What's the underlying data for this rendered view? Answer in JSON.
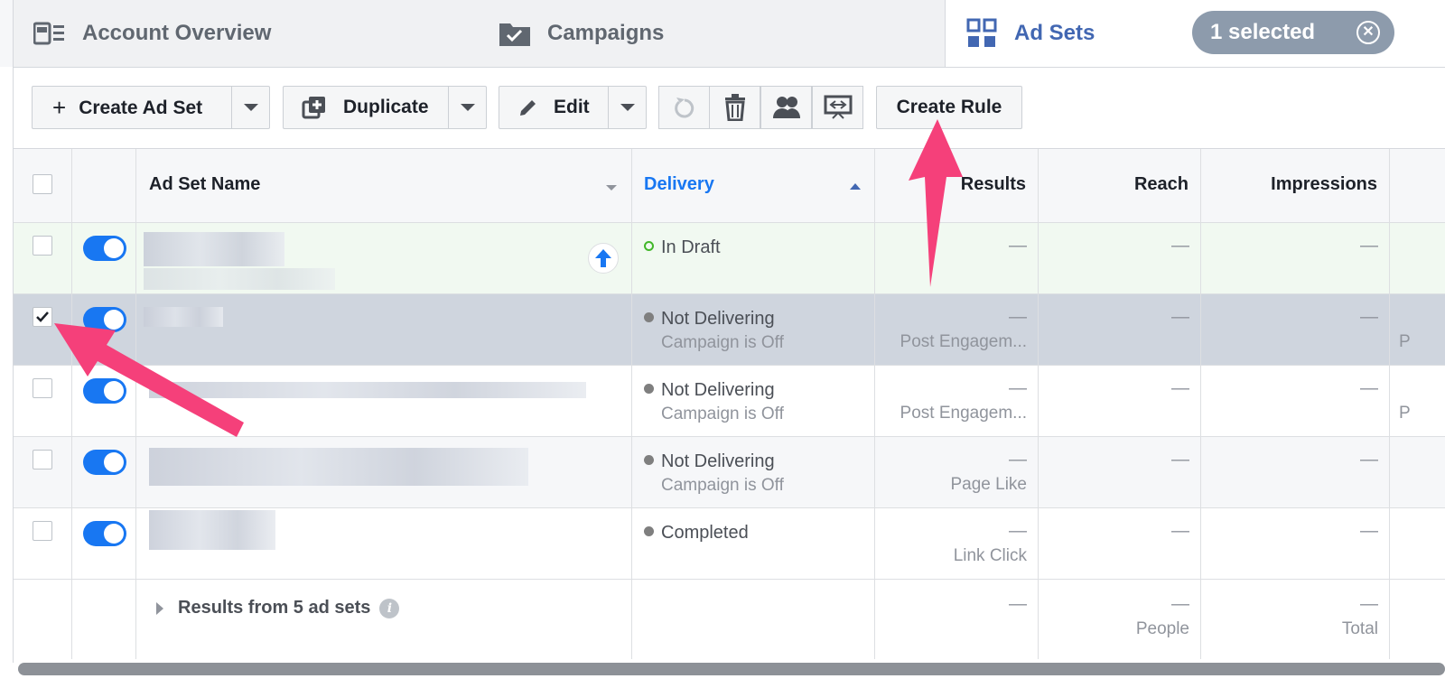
{
  "tabs": [
    {
      "label": "Account Overview",
      "icon": "account-overview-icon"
    },
    {
      "label": "Campaigns",
      "icon": "campaign-folder-icon"
    },
    {
      "label": "Ad Sets",
      "icon": "ad-sets-grid-icon"
    }
  ],
  "selection": {
    "label": "1 selected",
    "close_icon": "close-circle-icon"
  },
  "toolbar": {
    "create_label": "Create Ad Set",
    "duplicate_label": "Duplicate",
    "edit_label": "Edit",
    "create_rule_label": "Create Rule"
  },
  "table": {
    "headers": {
      "name": "Ad Set Name",
      "delivery": "Delivery",
      "results": "Results",
      "reach": "Reach",
      "impressions": "Impressions"
    },
    "dash": "—",
    "rows": [
      {
        "status": "In Draft",
        "sub": "",
        "result_sub": "",
        "checked": false
      },
      {
        "status": "Not Delivering",
        "sub": "Campaign is Off",
        "result_sub": "Post Engagem...",
        "checked": true
      },
      {
        "status": "Not Delivering",
        "sub": "Campaign is Off",
        "result_sub": "Post Engagem...",
        "checked": false
      },
      {
        "status": "Not Delivering",
        "sub": "Campaign is Off",
        "result_sub": "Page Like",
        "checked": false
      },
      {
        "status": "Completed",
        "sub": "",
        "result_sub": "Link Click",
        "checked": false
      }
    ],
    "summary": {
      "label": "Results from 5 ad sets",
      "reach_sub": "People",
      "impressions_sub": "Total"
    },
    "right_edge_letter": "P"
  },
  "colors": {
    "accent": "#4267b2",
    "toggle": "#1877f2",
    "selected_row": "#cfd5de",
    "draft_row": "#f1f9f1",
    "annotation_arrow": "#f5407a"
  }
}
